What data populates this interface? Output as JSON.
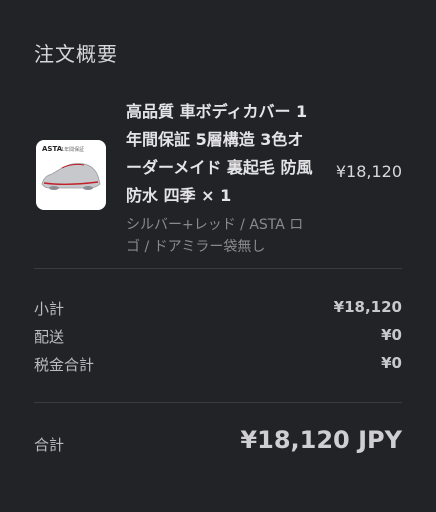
{
  "summary": {
    "title": "注文概要"
  },
  "product": {
    "name": "高品質 車ボディカバー 1年間保証 5層構造 3色オーダーメイド 裏起毛 防風防水 四季 × 1",
    "variant": "シルバー+レッド / ASTA ロゴ / ドアミラー袋無し",
    "price": "¥18,120",
    "thumbnail": {
      "brand": "ASTA",
      "sub": "1年間保証"
    }
  },
  "totals": {
    "subtotal_label": "小計",
    "subtotal_value": "¥18,120",
    "shipping_label": "配送",
    "shipping_value": "¥0",
    "tax_label": "税金合計",
    "tax_value": "¥0",
    "total_label": "合計",
    "total_value": "¥18,120 JPY"
  }
}
